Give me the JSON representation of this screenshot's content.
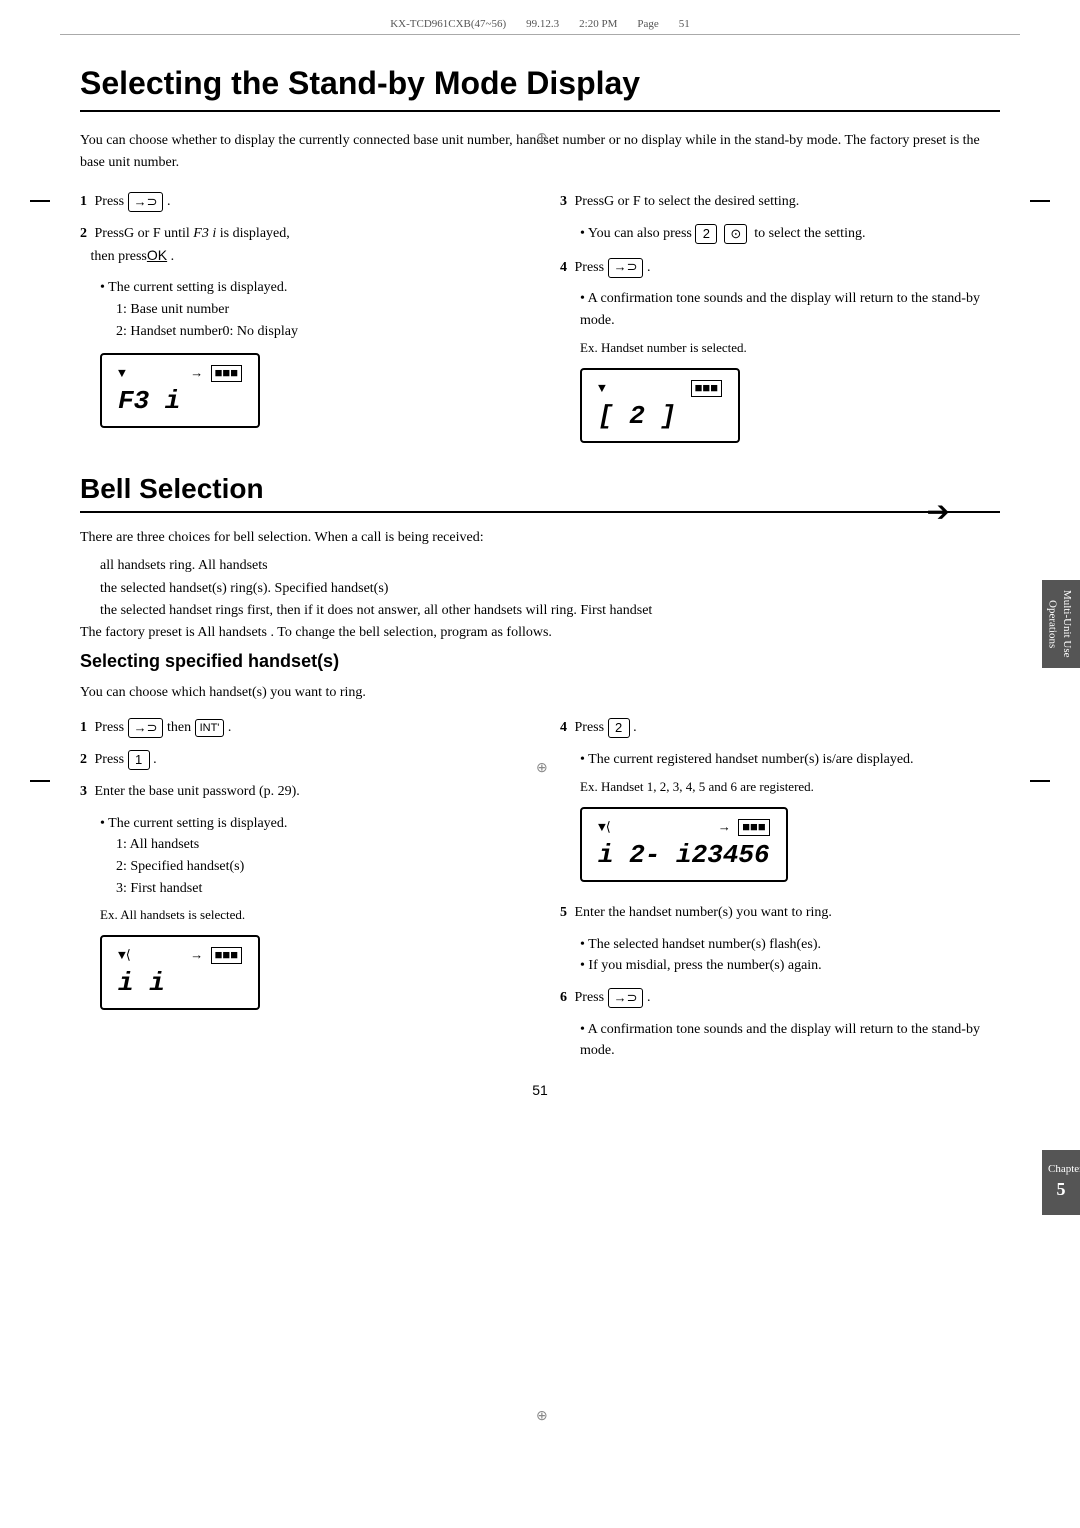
{
  "header": {
    "doc_id": "KX-TCD961CXB(47~56)",
    "date": "99.12.3",
    "time": "2:20 PM",
    "page_label": "Page",
    "page_num": "51"
  },
  "section1": {
    "title": "Selecting the Stand-by Mode Display",
    "intro": "You can choose whether to display the currently connected base unit number, handset number or no display while in the stand-by mode. The factory preset is the base unit number.",
    "steps": [
      {
        "num": "1",
        "text": "Press",
        "key": "→⊃",
        "suffix": "."
      },
      {
        "num": "2",
        "text": "PressG or F  until",
        "italic": "F3 i",
        "suffix": " is displayed, then press",
        "ok_key": "OK",
        "period": "."
      }
    ],
    "bullet1": "The current setting is displayed.",
    "sub_bullets": [
      "1: Base unit number",
      "2: Handset number0: No display"
    ],
    "lcd1": {
      "signal": "▼",
      "arrow": "→",
      "battery": "■■■",
      "main": "F3 i"
    },
    "right_steps": [
      {
        "num": "3",
        "text": "PressG or F  to select the desired setting."
      }
    ],
    "also_bullet": "You can also press",
    "also_key1": "2",
    "also_key2": "⊙",
    "also_suffix": "to select the setting.",
    "step4": {
      "num": "4",
      "text": "Press",
      "key": "→⊃",
      "period": "."
    },
    "step4_bullet": "A confirmation tone sounds and the display will return to the stand-by mode.",
    "ex_label": "Ex. Handset number is selected.",
    "lcd2": {
      "signal": "▼",
      "battery": "■■■",
      "main": "[ 2 ]"
    }
  },
  "section2": {
    "title": "Bell Selection",
    "arrow": "➔",
    "intro_lines": [
      "There are three choices for bell selection. When a call is being received:",
      " all handsets ring.  All handsets",
      " the selected handset(s) ring(s).  Specified handset(s)",
      "  the selected handset rings first, then if it does not answer, all other handsets will ring.  First handset",
      "The factory preset is  All handsets . To change the bell selection, program as follows."
    ],
    "sub_heading": "Selecting specified handset(s)",
    "sub_intro": "You can choose which handset(s) you want to ring.",
    "left_steps": [
      {
        "num": "1",
        "text": "Press",
        "key": "→⊃",
        "then": " then",
        "int_key": "INT'",
        "period": "."
      },
      {
        "num": "2",
        "text": "Press",
        "key": "1",
        "period": "."
      },
      {
        "num": "3",
        "text": "Enter the base unit password (p. 29)."
      }
    ],
    "step3_bullet": "The current setting is displayed.",
    "step3_subs": [
      "1: All handsets",
      "2: Specified handset(s)",
      "3: First handset"
    ],
    "ex2_label": "Ex. All handsets is selected.",
    "lcd3": {
      "signal": "▼",
      "signal2": "⟨",
      "arrow": "→",
      "battery": "■■■",
      "main": "i  i"
    },
    "right_steps2": [
      {
        "num": "4",
        "text": "Press",
        "key": "2",
        "period": "."
      }
    ],
    "step4r_bullet": "The current registered handset number(s) is/are displayed.",
    "ex3_label": "Ex. Handset 1, 2, 3, 4, 5 and 6 are registered.",
    "lcd4": {
      "signal": "▼",
      "signal2": "⟨",
      "arrow": "→",
      "battery": "■■■",
      "main": "i 2-  i23456"
    },
    "step5": {
      "num": "5",
      "text": "Enter the handset number(s) you want to ring."
    },
    "step5_bullets": [
      "The selected handset number(s) flash(es).",
      "If you misdial, press the number(s) again."
    ],
    "step6": {
      "num": "6",
      "text": "Press",
      "key": "→⊃",
      "period": "."
    },
    "step6_bullet": "A confirmation tone sounds and the display will return to the stand-by mode."
  },
  "sidebar": {
    "text1": "Multi-Unit Use",
    "text2": "Operations"
  },
  "chapter_tab": {
    "label": "Chapter",
    "number": "5"
  },
  "page_number": "51"
}
